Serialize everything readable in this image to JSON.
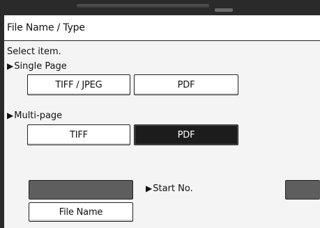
{
  "window": {
    "title": "File Name / Type"
  },
  "prompt": "Select item.",
  "single_page": {
    "heading": "Single Page",
    "options": [
      "TIFF / JPEG",
      "PDF"
    ]
  },
  "multi_page": {
    "heading": "Multi-page",
    "options": [
      "TIFF",
      "PDF"
    ],
    "selected": "PDF"
  },
  "file_name": {
    "button_label": "File Name"
  },
  "start_no": {
    "label": "Start No."
  },
  "colors": {
    "selected_button_bg": "#1c1c1c",
    "display_field_bg": "#5e5e5e"
  },
  "icons": {
    "section_marker": "play-triangle-icon"
  }
}
